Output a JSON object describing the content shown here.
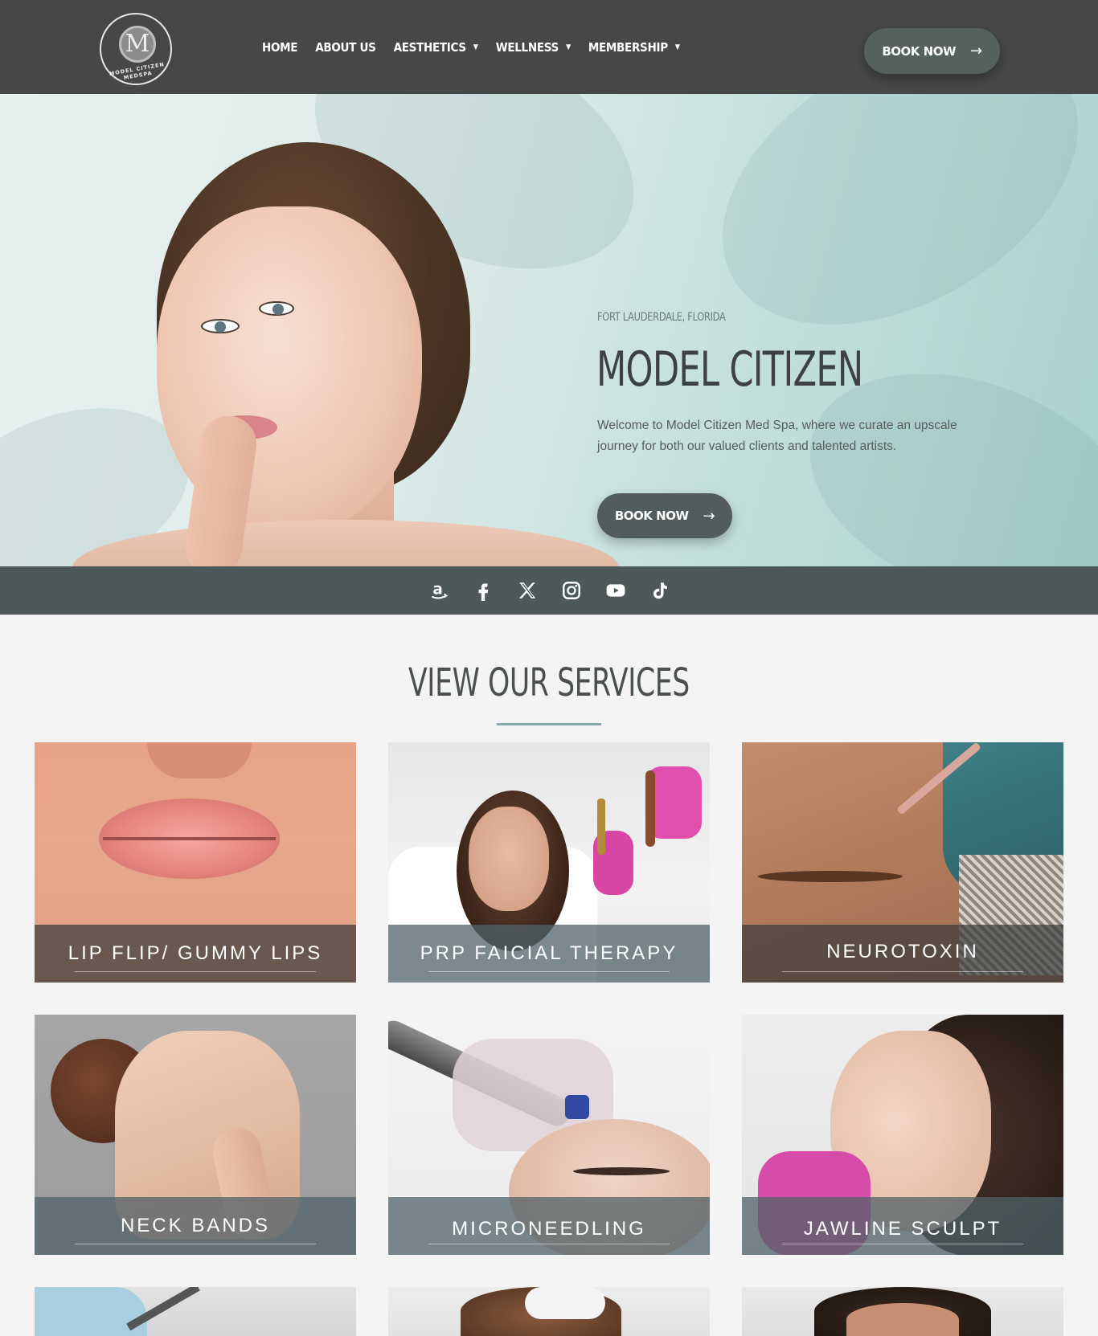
{
  "header": {
    "logo_letter": "M",
    "logo_text": "MODEL CITIZEN MEDSPA",
    "nav": [
      {
        "label": "HOME",
        "dropdown": false
      },
      {
        "label": "ABOUT US",
        "dropdown": false
      },
      {
        "label": "AESTHETICS",
        "dropdown": true
      },
      {
        "label": "WELLNESS",
        "dropdown": true
      },
      {
        "label": "MEMBERSHIP",
        "dropdown": true
      }
    ],
    "caret": "▼",
    "book_label": "BOOK NOW",
    "arrow": "→"
  },
  "hero": {
    "location": "FORT LAUDERDALE, FLORIDA",
    "title": "MODEL CITIZEN",
    "description": "Welcome to Model Citizen Med Spa, where we curate an upscale journey for both our valued clients and talented artists.",
    "book_label": "BOOK NOW",
    "arrow": "→"
  },
  "social": [
    "amazon-icon",
    "facebook-icon",
    "x-twitter-icon",
    "instagram-icon",
    "youtube-icon",
    "tiktok-icon"
  ],
  "services": {
    "title": "VIEW OUR SERVICES",
    "cards": [
      {
        "label": "LIP FLIP/ GUMMY LIPS"
      },
      {
        "label": "PRP FAICIAL THERAPY"
      },
      {
        "label": "NEUROTOXIN"
      },
      {
        "label": "NECK BANDS"
      },
      {
        "label": "MICRONEEDLING"
      },
      {
        "label": "JAWLINE SCULPT"
      }
    ]
  },
  "colors": {
    "header_bg": "#464848",
    "button_bg": "#55605f",
    "social_bar": "#4f5859",
    "accent_rule": "#88a6ab"
  }
}
